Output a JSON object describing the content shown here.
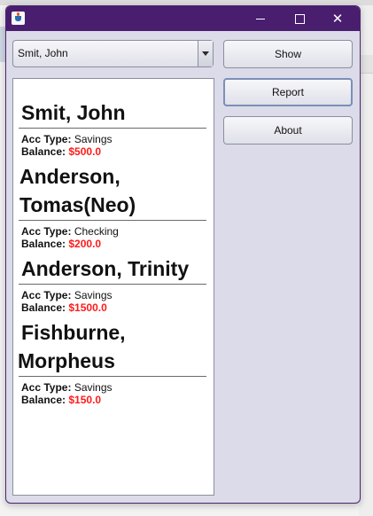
{
  "window": {
    "minimize_glyph": "minimize-icon",
    "maximize_glyph": "maximize-icon",
    "close_glyph": "✕"
  },
  "combo": {
    "selected": "Smit, John"
  },
  "buttons": {
    "show": "Show",
    "report": "Report",
    "about": "About"
  },
  "labels": {
    "acc_type": "Acc Type:",
    "balance": "Balance:"
  },
  "accounts": [
    {
      "name": "Smit, John",
      "name_lines": [
        "Smit, John"
      ],
      "acc_type": "Savings",
      "balance": "$500.0"
    },
    {
      "name": "Anderson, Tomas(Neo)",
      "name_lines": [
        "Anderson,",
        "Tomas(Neo)"
      ],
      "acc_type": "Checking",
      "balance": "$200.0"
    },
    {
      "name": "Anderson, Trinity",
      "name_lines": [
        "Anderson, Trinity"
      ],
      "acc_type": "Savings",
      "balance": "$1500.0"
    },
    {
      "name": "Fishburne, Morpheus",
      "name_lines": [
        "Fishburne,",
        "Morpheus"
      ],
      "acc_type": "Savings",
      "balance": "$150.0"
    }
  ],
  "colors": {
    "titlebar": "#4a1e6e",
    "window_bg": "#dcdbe9",
    "balance": "#ff1a1a"
  }
}
